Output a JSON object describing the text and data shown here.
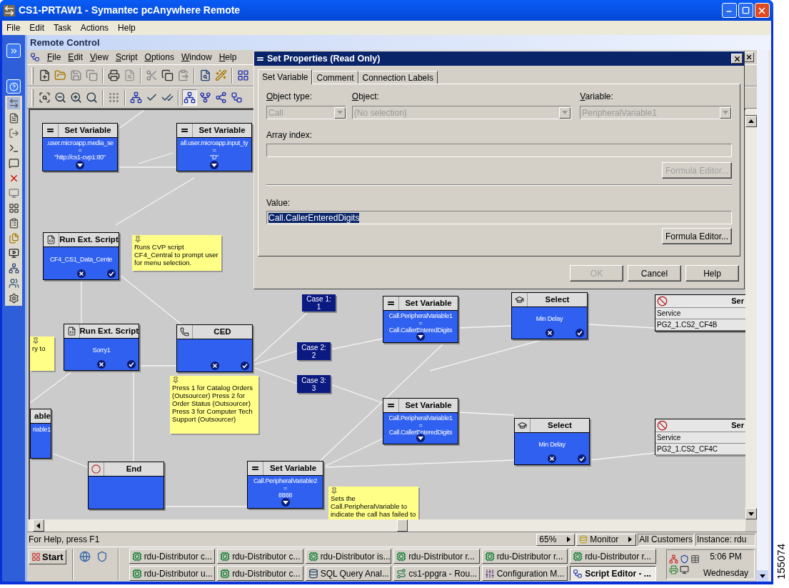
{
  "window": {
    "title": "CS1-PRTAW1 - Symantec pcAnywhere Remote"
  },
  "menu": [
    "File",
    "Edit",
    "Task",
    "Actions",
    "Help"
  ],
  "panel_title": "Remote Control",
  "editor": {
    "menu": [
      "File",
      "Edit",
      "View",
      "Script",
      "Options",
      "Window",
      "Help"
    ],
    "nodes": [
      {
        "kind": "set_variable",
        "title": "Set Variable",
        "lines": [
          ".user.microapp.media_se",
          "=",
          "\"http://cs1-cvp1:80\""
        ]
      },
      {
        "kind": "set_variable",
        "title": "Set Variable",
        "lines": [
          "all.user.microapp.input_ty",
          "=",
          "\"D\""
        ]
      },
      {
        "kind": "run_script",
        "title": "Run Ext. Script",
        "lines": [
          "CF4_CS1_Data_Cente"
        ]
      },
      {
        "kind": "note",
        "text": "Runs CVP script CF4_Central to prompt user for menu selection."
      },
      {
        "kind": "run_script",
        "title": "Run Ext. Script",
        "lines": [
          "Sorry1"
        ]
      },
      {
        "kind": "ced",
        "title": "CED"
      },
      {
        "kind": "note",
        "text": "ry to"
      },
      {
        "kind": "case",
        "label": "Case 1:",
        "value": "1"
      },
      {
        "kind": "case",
        "label": "Case 2:",
        "value": "2"
      },
      {
        "kind": "case",
        "label": "Case 3:",
        "value": "3"
      },
      {
        "kind": "set_variable",
        "title": "Set Variable",
        "lines": [
          "Call.PeripheralVariable1",
          "=",
          "Call.CallerEnteredDigits"
        ]
      },
      {
        "kind": "select",
        "title": "Select",
        "lines": [
          "Min Delay"
        ]
      },
      {
        "kind": "service",
        "title": "Ser",
        "rows": [
          "Service",
          "PG2_1.CS2_CF4B"
        ]
      },
      {
        "kind": "note",
        "text": "Press 1 for Catalog Orders (Outsourcer) Press 2 for Order Status (Outsourcer) Press 3 for Computer Tech Support  (Outsourcer)"
      },
      {
        "kind": "set_variable",
        "title": "Set Variable",
        "lines": [
          "Call.PeripheralVariable1",
          "=",
          "Call.CallerEnteredDigits"
        ]
      },
      {
        "kind": "select",
        "title": "Select",
        "lines": [
          "Min Delay"
        ]
      },
      {
        "kind": "service",
        "title": "Ser",
        "rows": [
          "Service",
          "PG2_1.CS2_CF4C"
        ]
      },
      {
        "kind": "partial",
        "title": "able",
        "lines": [
          "riable1"
        ]
      },
      {
        "kind": "end",
        "title": "End"
      },
      {
        "kind": "set_variable",
        "title": "Set Variable",
        "lines": [
          "Call.PeripheralVariable2",
          "=",
          "8888"
        ]
      },
      {
        "kind": "note",
        "text": "Sets the Call.PeripheralVariable to indicate the call has failed to"
      }
    ],
    "dialog": {
      "title": "Set Properties (Read Only)",
      "tabs": [
        {
          "label": "Set Variable",
          "selected": true
        },
        {
          "label": "Comment",
          "selected": false
        },
        {
          "label": "Connection Labels",
          "selected": false
        }
      ],
      "selects": [
        {
          "label": "Object type:",
          "value": "Call",
          "disabled": true
        },
        {
          "label": "Object:",
          "value": "(No selection)",
          "disabled": true
        },
        {
          "label": "Variable:",
          "value": "PeripheralVariable1",
          "disabled": true
        }
      ],
      "array_index": {
        "label": "Array index:"
      },
      "formula_editor_top": {
        "label": "Formula Editor...",
        "disabled": true
      },
      "value": {
        "label": "Value:",
        "value": "Call.CallerEnteredDigits"
      },
      "formula_editor_bottom": {
        "label": "Formula Editor...",
        "disabled": false
      },
      "buttons": [
        {
          "label": "OK",
          "disabled": true
        },
        {
          "label": "Cancel",
          "disabled": false
        },
        {
          "label": "Help",
          "disabled": false
        }
      ]
    },
    "status_bar": {
      "help": "For Help, press F1",
      "zoom": "65%",
      "mode": "Monitor",
      "customer": "All Customers",
      "instance": "Instance: rdu"
    }
  },
  "taskbar": {
    "start": "Start",
    "tasks": [
      {
        "label": "rdu-Distributor c...",
        "kind": "cisco",
        "selected": false
      },
      {
        "label": "rdu-Distributor c...",
        "kind": "cisco",
        "selected": false
      },
      {
        "label": "rdu-Distributor is...",
        "kind": "cisco",
        "selected": false
      },
      {
        "label": "rdu-Distributor r...",
        "kind": "cisco",
        "selected": false
      },
      {
        "label": "rdu-Distributor r...",
        "kind": "cisco",
        "selected": false
      },
      {
        "label": "rdu-Distributor r...",
        "kind": "cisco",
        "selected": false
      },
      {
        "label": "rdu-Distributor u...",
        "kind": "cisco",
        "selected": false
      },
      {
        "label": "rdu-Distributor c...",
        "kind": "cisco",
        "selected": false
      },
      {
        "label": "SQL Query Anal...",
        "kind": "sql",
        "selected": false
      },
      {
        "label": "cs1-ppgra - Rou...",
        "kind": "router",
        "selected": false
      },
      {
        "label": "Configuration M...",
        "kind": "config",
        "selected": false
      },
      {
        "label": "Script Editor - ...",
        "kind": "script",
        "selected": true
      }
    ],
    "clock": "5:06 PM",
    "day": "Wednesday"
  },
  "figure_id": "155074"
}
